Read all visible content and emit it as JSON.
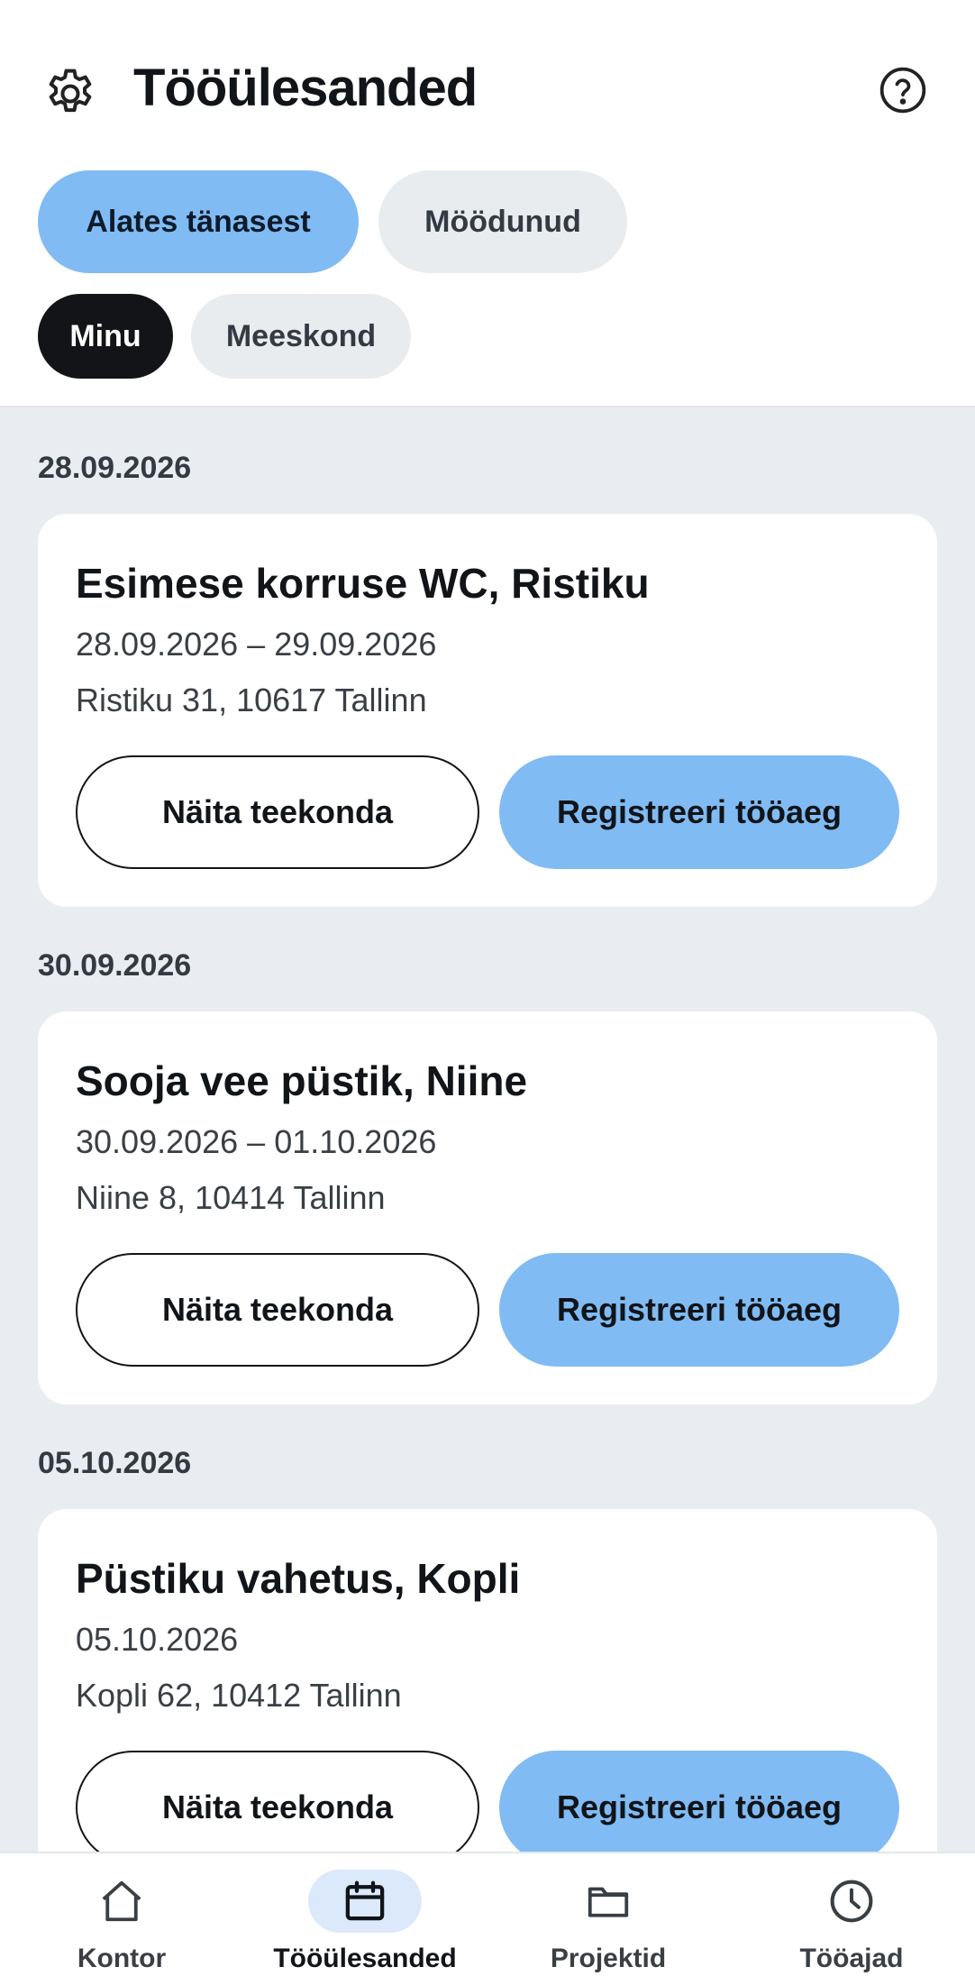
{
  "header": {
    "title": "Tööülesanded",
    "settings_icon": "gear-icon",
    "help_icon": "help-circle-icon"
  },
  "filters": {
    "time": [
      {
        "label": "Alates tänasest",
        "active": true
      },
      {
        "label": "Möödunud",
        "active": false
      }
    ],
    "scope": [
      {
        "label": "Minu",
        "active": true
      },
      {
        "label": "Meeskond",
        "active": false
      }
    ]
  },
  "tasks": [
    {
      "date_heading": "28.09.2026",
      "title": "Esimese korruse WC, Ristiku",
      "dates": "28.09.2026 – 29.09.2026",
      "address": "Ristiku 31, 10617 Tallinn",
      "route_label": "Näita teekonda",
      "register_label": "Registreeri tööaeg"
    },
    {
      "date_heading": "30.09.2026",
      "title": "Sooja vee püstik, Niine",
      "dates": "30.09.2026 – 01.10.2026",
      "address": "Niine 8, 10414 Tallinn",
      "route_label": "Näita teekonda",
      "register_label": "Registreeri tööaeg"
    },
    {
      "date_heading": "05.10.2026",
      "title": "Püstiku vahetus, Kopli",
      "dates": "05.10.2026",
      "address": "Kopli 62, 10412 Tallinn",
      "route_label": "Näita teekonda",
      "register_label": "Registreeri tööaeg"
    }
  ],
  "nav": [
    {
      "label": "Kontor",
      "icon": "home-icon",
      "active": false
    },
    {
      "label": "Tööülesanded",
      "icon": "calendar-icon",
      "active": true
    },
    {
      "label": "Projektid",
      "icon": "folder-icon",
      "active": false
    },
    {
      "label": "Tööajad",
      "icon": "clock-icon",
      "active": false
    }
  ],
  "colors": {
    "accent": "#80bbf4",
    "dark_chip": "#121417",
    "content_bg": "#e9edf1",
    "nav_active_bg": "#dbe9fa"
  }
}
